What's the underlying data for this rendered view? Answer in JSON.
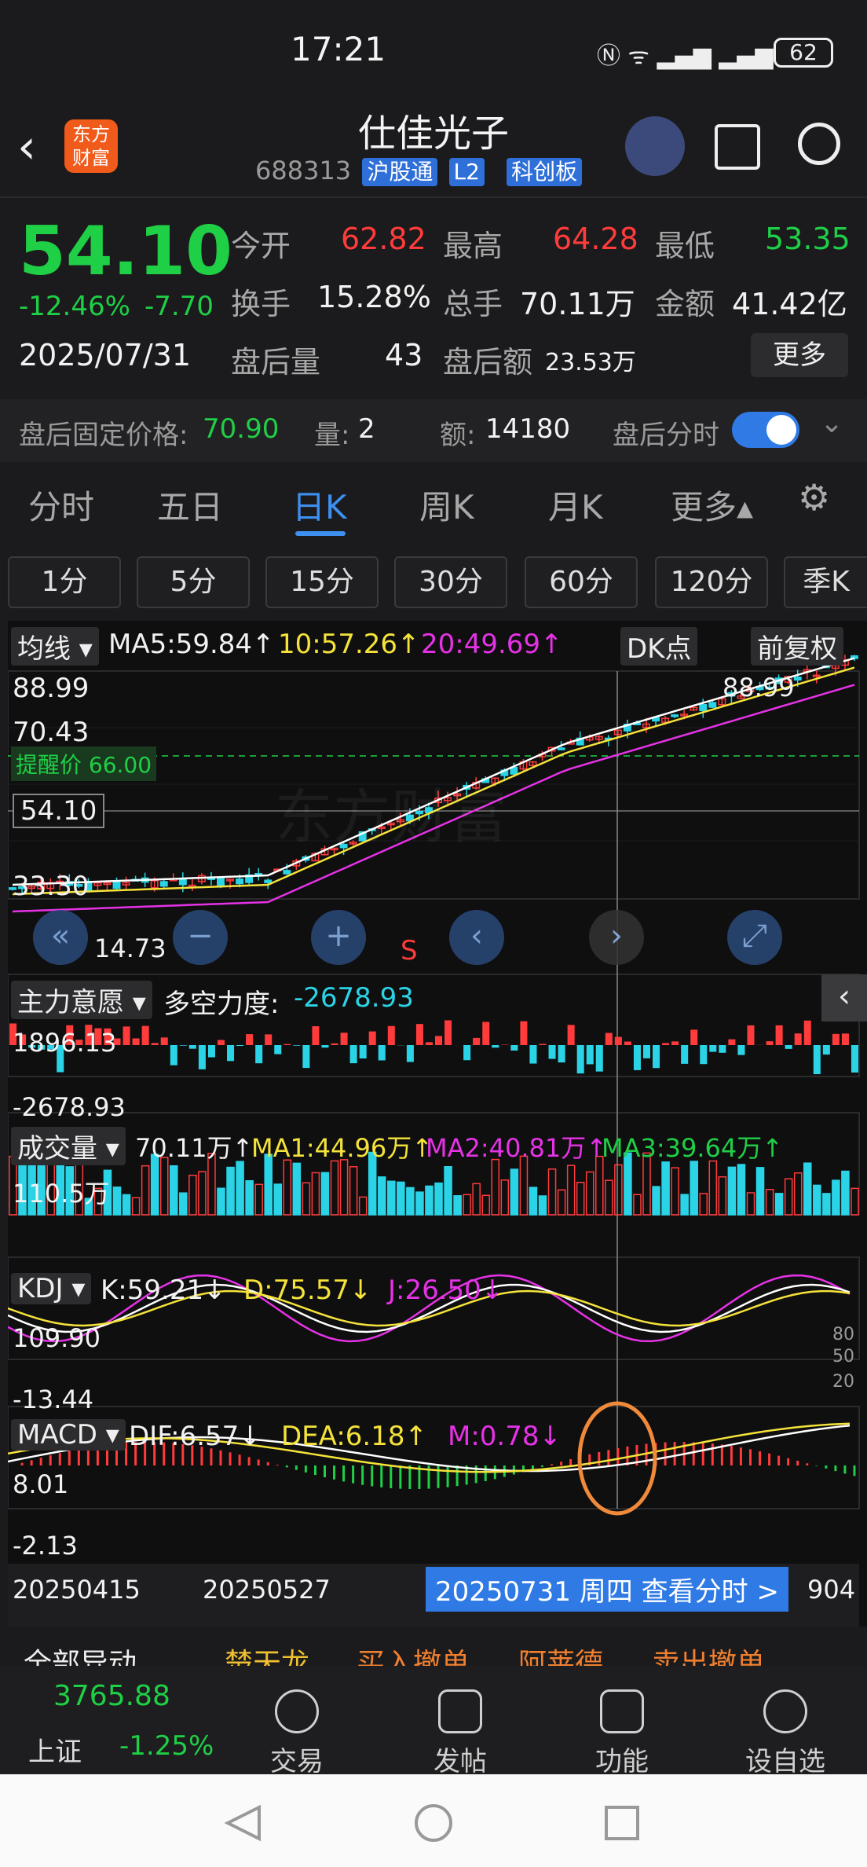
{
  "status": {
    "time": "17:21",
    "battery": "62"
  },
  "header": {
    "logo": "东方\n财富",
    "title": "仕佳光子",
    "code": "688313",
    "tags": [
      "沪股通",
      "L2",
      "科创板"
    ]
  },
  "quote": {
    "price": "54.10",
    "change_pct": "-12.46%",
    "change": "-7.70",
    "date": "2025/07/31",
    "open_label": "今开",
    "open": "62.82",
    "high_label": "最高",
    "high": "64.28",
    "low_label": "最低",
    "low": "53.35",
    "turnover_label": "换手",
    "turnover": "15.28%",
    "volume_label": "总手",
    "volume": "70.11万",
    "amount_label": "金额",
    "amount": "41.42亿",
    "after_vol_label": "盘后量",
    "after_vol": "43",
    "after_amt_label": "盘后额",
    "after_amt": "23.53万",
    "more": "更多"
  },
  "afterhours": {
    "fixed_label": "盘后固定价格:",
    "fixed": "70.90",
    "qty_label": "量:",
    "qty": "2",
    "amt_label": "额:",
    "amt": "14180",
    "toggle_label": "盘后分时"
  },
  "tabs": [
    "分时",
    "五日",
    "日K",
    "周K",
    "月K",
    "更多▴"
  ],
  "periods": [
    "1分",
    "5分",
    "15分",
    "30分",
    "60分",
    "120分",
    "季K"
  ],
  "main_chart": {
    "ma_dropdown": "均线",
    "ma5": "MA5:59.84↑",
    "ma10": "10:57.26↑",
    "ma20": "20:49.69↑",
    "dk": "DK点",
    "fq": "前复权",
    "y_top": "88.99",
    "y_2": "70.43",
    "alert": "提醒价 66.00",
    "current": "54.10",
    "y_3": "33.30",
    "y_low": "14.73",
    "high_mark": "88.99",
    "low_mark": "14.73",
    "signal": "S",
    "watermark": "东方财富"
  },
  "force": {
    "dropdown": "主力意愿",
    "label": "多空力度:",
    "value": "-2678.93",
    "top": "1896.13",
    "bottom": "-2678.93"
  },
  "volume": {
    "dropdown": "成交量",
    "val": "70.11万↑",
    "ma1": "MA1:44.96万↑",
    "ma2": "MA2:40.81万↑",
    "ma3": "MA3:39.64万↑",
    "top": "110.5万"
  },
  "kdj": {
    "dropdown": "KDJ",
    "k": "K:59.21↓",
    "d": "D:75.57↓",
    "j": "J:26.50↓",
    "top": "109.90",
    "bottom": "-13.44",
    "r80": "80",
    "r50": "50",
    "r20": "20"
  },
  "macd": {
    "dropdown": "MACD",
    "dif": "DIF:6.57↓",
    "dea": "DEA:6.18↑",
    "m": "M:0.78↓",
    "top": "8.01",
    "bottom": "-2.13"
  },
  "dates": {
    "d1": "20250415",
    "d2": "20250527",
    "selected": "20250731 周四 查看分时 >",
    "d3": "904"
  },
  "ticker": [
    "全部异动",
    "楚天龙",
    "买入撤单",
    "阿莱德",
    "卖出撤单"
  ],
  "bottom": {
    "index_value": "3765.88",
    "index_name": "上证",
    "index_change": "-1.25%",
    "nav": [
      "交易",
      "发帖",
      "功能",
      "设自选"
    ]
  },
  "colors": {
    "up": "#ff3b3b",
    "down": "#1fcf46",
    "accent": "#3d8ff0",
    "cyan_bar": "#2ad4e6"
  }
}
